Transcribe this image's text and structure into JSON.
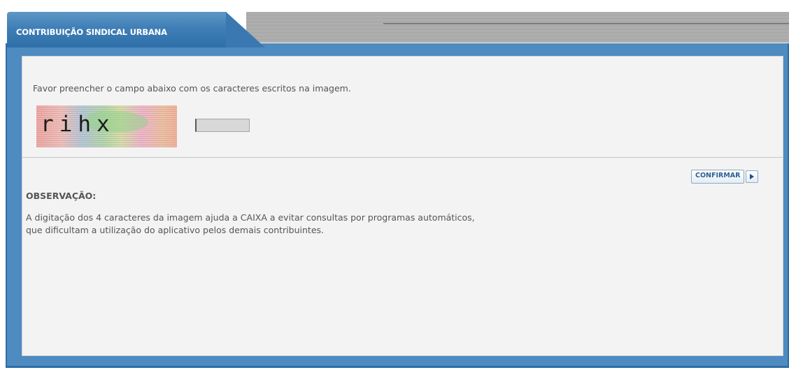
{
  "tab": {
    "title": "CONTRIBUIÇÃO SINDICAL URBANA"
  },
  "form": {
    "instruction": "Favor preencher o campo abaixo com os caracteres escritos na imagem.",
    "captcha_text": "rihx",
    "input_value": "",
    "confirm_label": "CONFIRMAR"
  },
  "observation": {
    "title": "OBSERVAÇÃO:",
    "line1": "A digitação dos 4 caracteres da imagem ajuda a CAIXA a evitar consultas por programas automáticos,",
    "line2": "que dificultam a utilização do aplicativo pelos demais contribuintes."
  },
  "icons": {
    "confirm_arrow": "play-arrow-icon"
  },
  "colors": {
    "tab_blue": "#3f7eb6",
    "panel_border": "#4e8bc0",
    "panel_bg": "#f3f3f3",
    "button_text": "#2d5f95"
  }
}
